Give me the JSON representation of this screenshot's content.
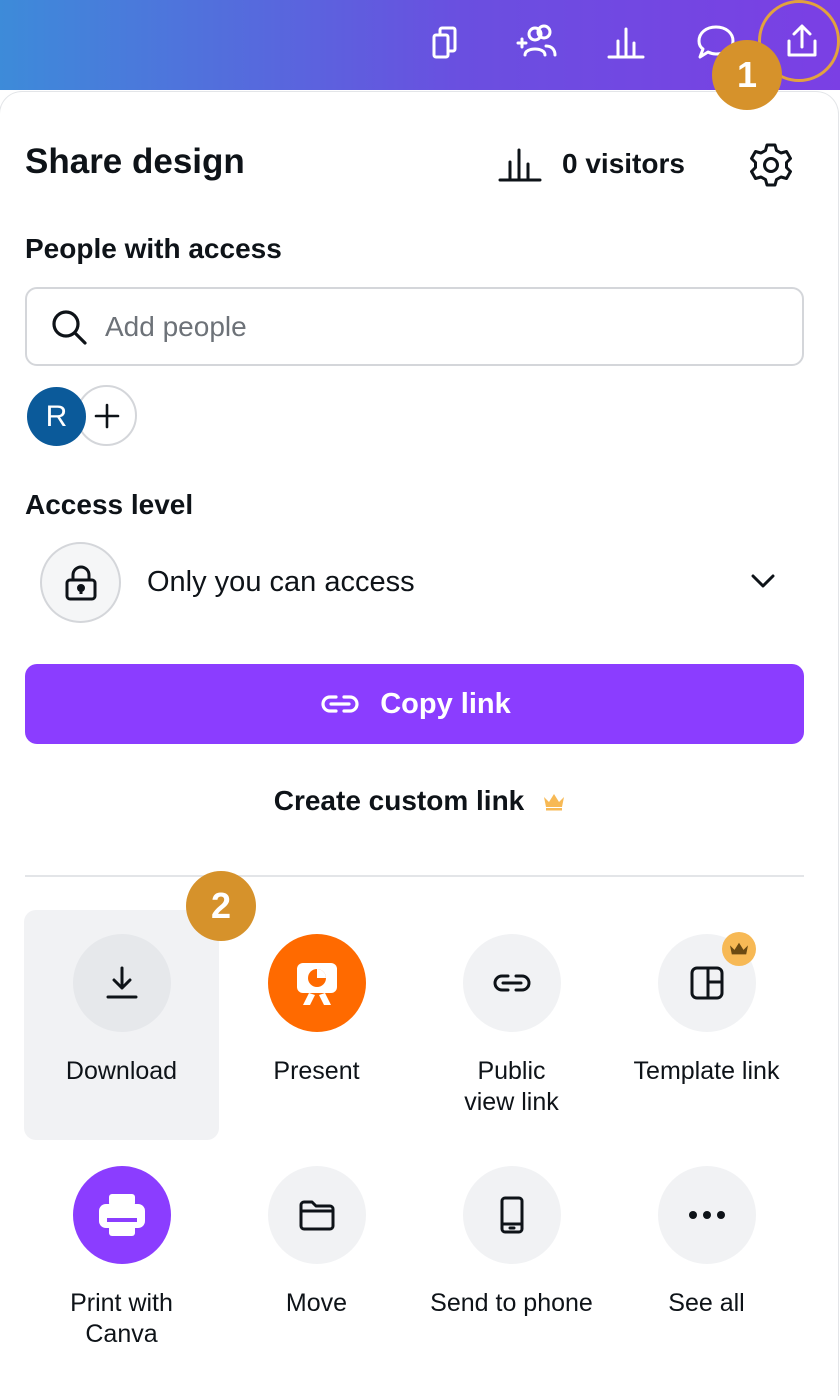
{
  "panel": {
    "title": "Share design",
    "visitors_label": "0 visitors"
  },
  "people": {
    "heading": "People with access",
    "search_placeholder": "Add people",
    "avatar_initial": "R"
  },
  "access": {
    "heading": "Access level",
    "current": "Only you can access"
  },
  "actions": {
    "copy_link": "Copy link",
    "custom_link": "Create custom link"
  },
  "markers": {
    "m1": "1",
    "m2": "2"
  },
  "tiles": [
    {
      "label": "Download"
    },
    {
      "label": "Present"
    },
    {
      "label": "Public\nview link"
    },
    {
      "label": "Template link"
    },
    {
      "label": "Print with\nCanva"
    },
    {
      "label": "Move"
    },
    {
      "label": "Send to phone"
    },
    {
      "label": "See all"
    }
  ],
  "colors": {
    "accent": "#8b3dff",
    "present": "#ff6a00",
    "marker": "#d6922b",
    "crown": "#f7b955"
  }
}
